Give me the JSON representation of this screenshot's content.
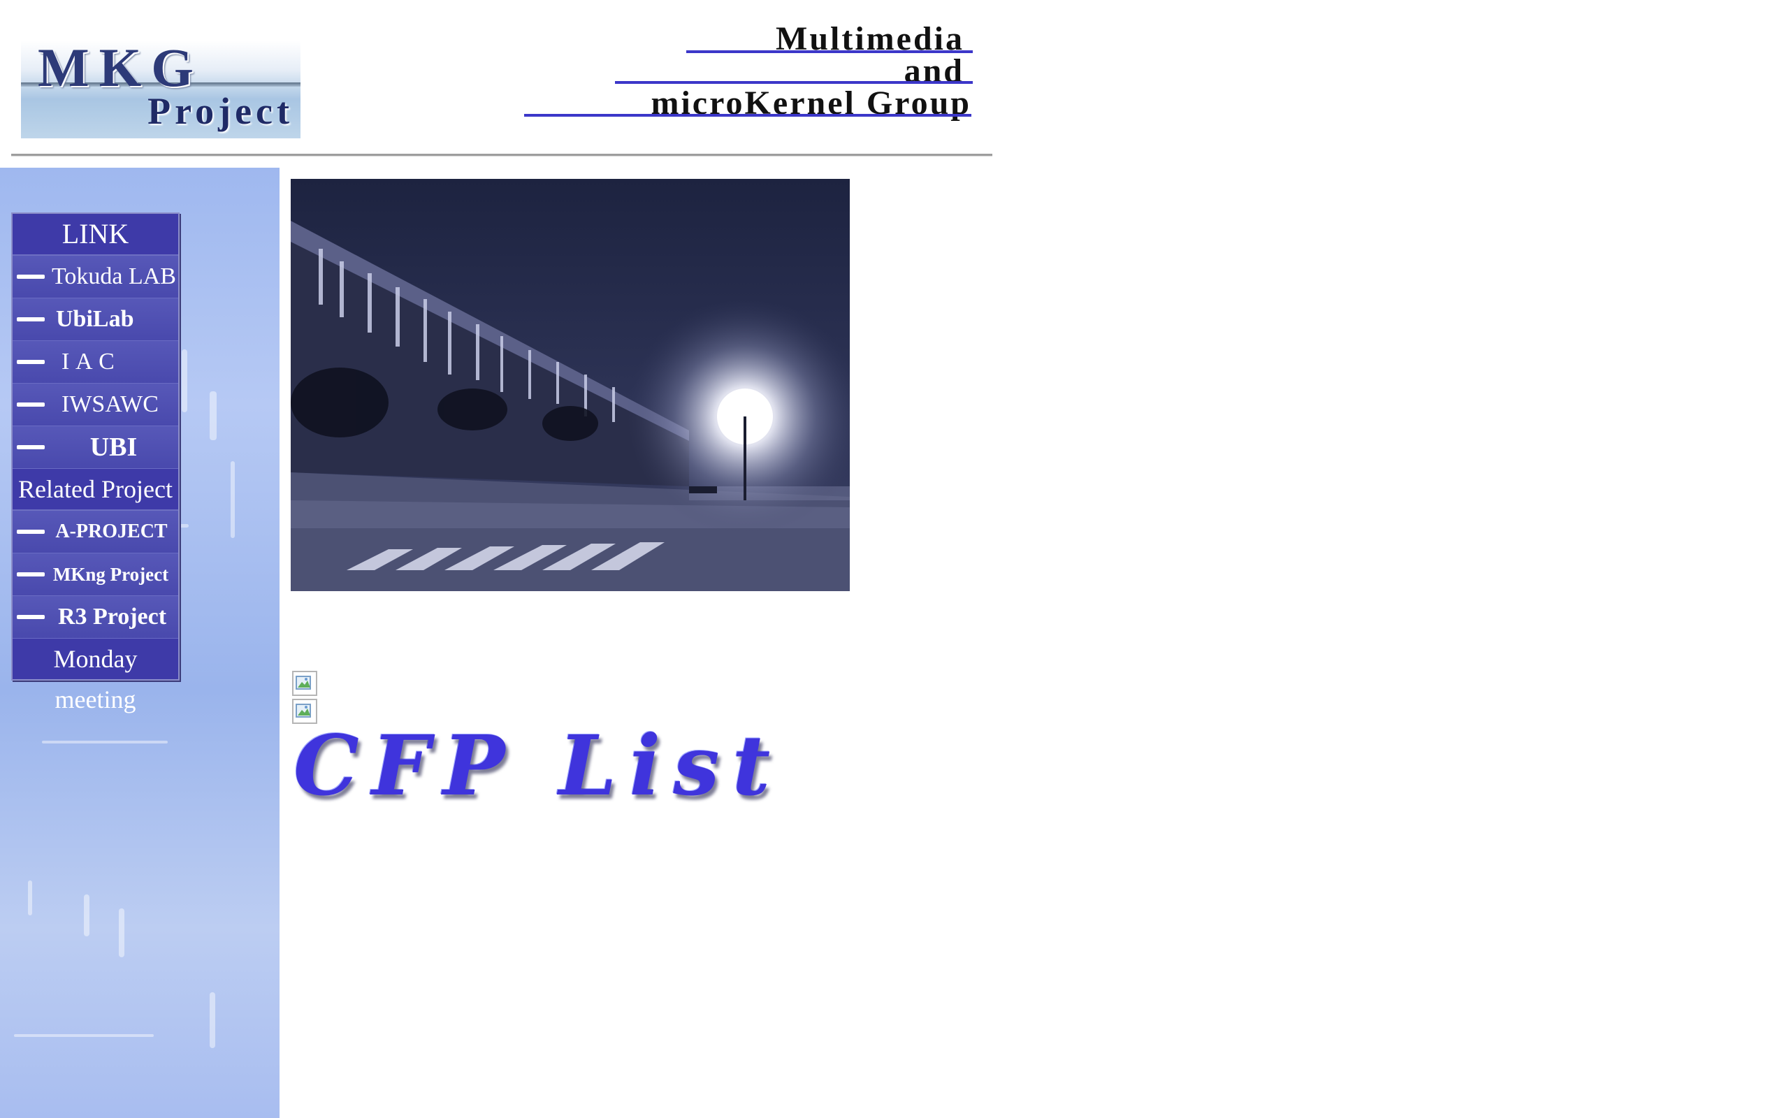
{
  "header": {
    "logo": {
      "line1": "MKG",
      "line2": "Project"
    },
    "tagline": {
      "line1": "Multimedia",
      "line2": "and",
      "line3": "microKernel Group"
    },
    "accent_color": "#3c37c9"
  },
  "sidebar": {
    "sections": [
      {
        "header": "LINK",
        "items": [
          {
            "label": "Tokuda LAB"
          },
          {
            "label": "UbiLab"
          },
          {
            "label": "I A C"
          },
          {
            "label": "IWSAWC"
          },
          {
            "label": "UBI"
          }
        ]
      },
      {
        "header": "Related Project",
        "items": [
          {
            "label": "A-PROJECT"
          },
          {
            "label": "MKng Project"
          },
          {
            "label": "R3 Project"
          }
        ]
      }
    ],
    "footer_link": "Monday meeting",
    "menu_color": "#4b4ab1",
    "background_color": "#a8bdf0"
  },
  "main": {
    "cfp_title": "CFP List",
    "title_color": "#3f34dc"
  }
}
